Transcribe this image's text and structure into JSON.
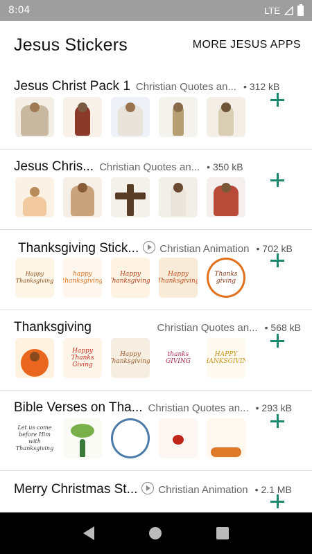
{
  "status": {
    "time": "8:04",
    "network": "LTE"
  },
  "header": {
    "title": "Jesus Stickers",
    "more_label": "MORE JESUS APPS"
  },
  "packs": [
    {
      "name": "Jesus Christ Pack 1",
      "publisher": "Christian Quotes an...",
      "size": "312 kB",
      "animated": false,
      "stickers": [
        "jesus-group-sticker",
        "jesus-bread-sticker",
        "jesus-portrait-sticker",
        "jesus-lamb-sticker",
        "jesus-standing-sticker"
      ]
    },
    {
      "name": "Jesus Chris...",
      "publisher": "Christian Quotes an...",
      "size": "350 kB",
      "animated": false,
      "stickers": [
        "girl-praying-sticker",
        "jesus-embrace-sticker",
        "cross-sticker",
        "jesus-arms-open-sticker",
        "jesus-risen-sticker"
      ]
    },
    {
      "name": "Thanksgiving Stick...",
      "publisher": "Christian Animation",
      "size": "702 kB",
      "animated": true,
      "stickers": [
        "thanksgiving-banner-sticker",
        "happy-thanksgiving-script-sticker",
        "turkey-thanksgiving-sticker",
        "happy-thanksgiving-cloud-sticker",
        "thanks-giving-wreath-sticker"
      ]
    },
    {
      "name": "Thanksgiving",
      "publisher": "Christian Quotes an...",
      "size": "568 kB",
      "animated": false,
      "stickers": [
        "turkey-sticker",
        "happy-thanks-giving-turkey-sticker",
        "bears-thanksgiving-sticker",
        "thanks-giving-text-sticker",
        "happy-thanksgiving-gold-sticker"
      ]
    },
    {
      "name": "Bible Verses on Tha...",
      "publisher": "Christian Quotes an...",
      "size": "293 kB",
      "animated": false,
      "stickers": [
        "verse-thanksgiving-sticker",
        "verse-tree-sticker",
        "verse-wreath-sticker",
        "verse-heart-sticker",
        "verse-pumpkins-sticker"
      ]
    },
    {
      "name": "Merry Christmas St...",
      "publisher": "Christian Animation",
      "size": "2.1 MB",
      "animated": true,
      "stickers": []
    }
  ],
  "sticker_texts": {
    "thanksgiving_banner": "Happy Thanksgiving",
    "happy_thanksgiving": "happy thanksgiving",
    "turkey_thanksgiving": "Happy Thanksgiving!",
    "cloud_thanksgiving": "Happy Thanksgiving",
    "wreath_thanks": "Thanks giving",
    "happy_thanks_giving": "Happy Thanks Giving",
    "bears_thanksgiving": "Happy Thanksgiving!",
    "thanks_giving": "thanks GIVING",
    "gold_thanksgiving": "HAPPY THANKSGIVING",
    "verse_thanksgiving": "Let us come before Him with Thanksgiving"
  },
  "colors": {
    "accent": "#1a8a6e",
    "status_bar": "#9e9e9e",
    "nav_bar": "#000000"
  }
}
